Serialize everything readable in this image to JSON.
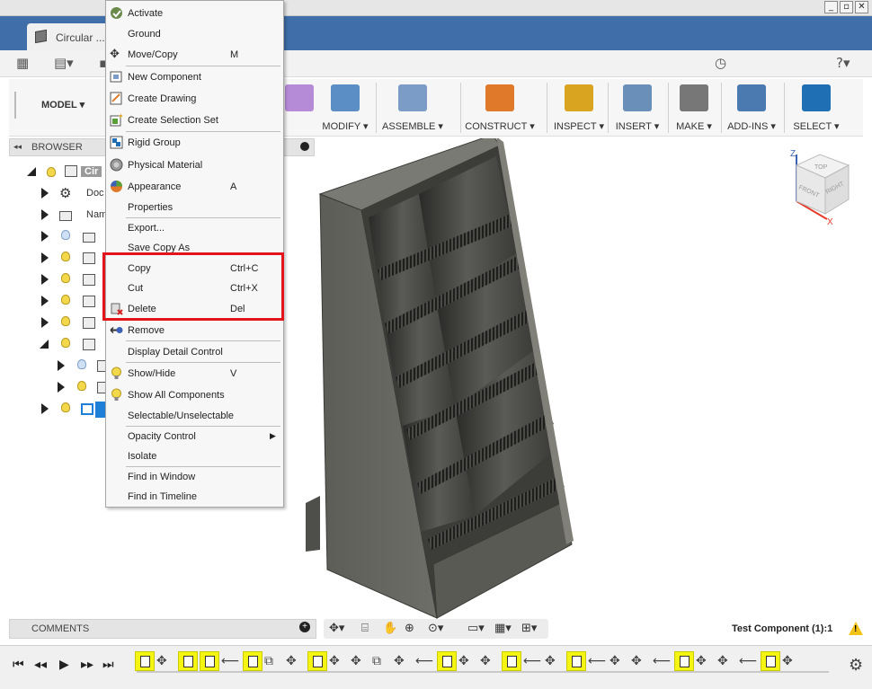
{
  "window": {
    "min": "_",
    "max": "▫",
    "close": "✕"
  },
  "document_tab": {
    "title": "Circular ..."
  },
  "toolbar": {
    "workspace": "MODEL ▾",
    "groups": [
      {
        "label": "MODIFY ▾",
        "icon": "modify-icon",
        "color": "#5a8ec4"
      },
      {
        "label": "ASSEMBLE ▾",
        "icon": "assemble-icon",
        "color": "#7a9cc6"
      },
      {
        "label": "CONSTRUCT ▾",
        "icon": "construct-icon",
        "color": "#e07a2a"
      },
      {
        "label": "INSPECT ▾",
        "icon": "inspect-icon",
        "color": "#d9a520"
      },
      {
        "label": "INSERT ▾",
        "icon": "insert-icon",
        "color": "#6a8fb8"
      },
      {
        "label": "MAKE ▾",
        "icon": "make-icon",
        "color": "#777777"
      },
      {
        "label": "ADD-INS ▾",
        "icon": "add-ins-icon",
        "color": "#4a7ab0"
      },
      {
        "label": "SELECT ▾",
        "icon": "select-icon",
        "color": "#1e6fb3"
      }
    ]
  },
  "browser": {
    "title": "BROWSER",
    "rows": [
      {
        "text": "Cir",
        "icon": "component-icon"
      },
      {
        "text": "Doc",
        "icon": "settings-icon"
      },
      {
        "text": "Nam",
        "icon": "folder-icon"
      }
    ]
  },
  "context_menu": {
    "items": [
      {
        "label": "Activate",
        "shortcut": "",
        "icon": "check-icon"
      },
      {
        "label": "Ground",
        "shortcut": "",
        "icon": ""
      },
      {
        "label": "Move/Copy",
        "shortcut": "M",
        "icon": "move-icon"
      },
      {
        "label": "New Component",
        "shortcut": "",
        "icon": "new-component-icon"
      },
      {
        "label": "Create Drawing",
        "shortcut": "",
        "icon": "drawing-icon"
      },
      {
        "label": "Create Selection Set",
        "shortcut": "",
        "icon": "selection-set-icon"
      },
      {
        "label": "Rigid Group",
        "shortcut": "",
        "icon": "rigid-group-icon"
      },
      {
        "label": "Physical Material",
        "shortcut": "",
        "icon": "material-icon"
      },
      {
        "label": "Appearance",
        "shortcut": "A",
        "icon": "appearance-icon"
      },
      {
        "label": "Properties",
        "shortcut": "",
        "icon": ""
      },
      {
        "label": "Export...",
        "shortcut": "",
        "icon": ""
      },
      {
        "label": "Save Copy As",
        "shortcut": "",
        "icon": ""
      },
      {
        "label": "Copy",
        "shortcut": "Ctrl+C",
        "icon": ""
      },
      {
        "label": "Cut",
        "shortcut": "Ctrl+X",
        "icon": ""
      },
      {
        "label": "Delete",
        "shortcut": "Del",
        "icon": "delete-icon"
      },
      {
        "label": "Remove",
        "shortcut": "",
        "icon": "remove-icon"
      },
      {
        "label": "Display Detail Control",
        "shortcut": "",
        "icon": ""
      },
      {
        "label": "Show/Hide",
        "shortcut": "V",
        "icon": "lightbulb-icon"
      },
      {
        "label": "Show All Components",
        "shortcut": "",
        "icon": "lightbulb-icon"
      },
      {
        "label": "Selectable/Unselectable",
        "shortcut": "",
        "icon": ""
      },
      {
        "label": "Opacity Control",
        "shortcut": "",
        "icon": ""
      },
      {
        "label": "Isolate",
        "shortcut": "",
        "icon": ""
      },
      {
        "label": "Find in Window",
        "shortcut": "",
        "icon": ""
      },
      {
        "label": "Find in Timeline",
        "shortcut": "",
        "icon": ""
      }
    ],
    "submenu_arrow": "▶"
  },
  "viewcube": {
    "top": "TOP",
    "front": "FRONT",
    "right": "RIGHT",
    "z": "Z",
    "x": "X"
  },
  "comments": {
    "title": "COMMENTS",
    "add": "+"
  },
  "status": {
    "text": "Test Component (1):1",
    "warning": "!"
  },
  "colors": {
    "highlight": "#e3141c",
    "timeline_feature": "#f5f512",
    "title_bar": "#3f6ea8"
  }
}
